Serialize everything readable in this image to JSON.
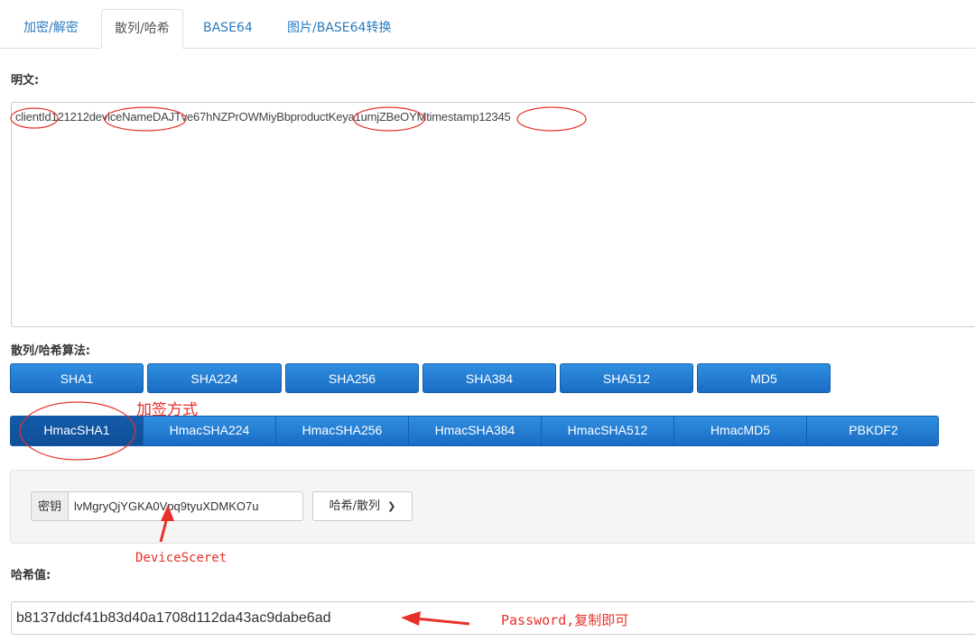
{
  "tabs": [
    "加密/解密",
    "散列/哈希",
    "BASE64",
    "图片/BASE64转换"
  ],
  "plaintext_label": "明文:",
  "plaintext": "clientId121212deviceNameDAJTve67hNZPrOWMiyBbproductKeya1umjZBeOYMtimestamp12345",
  "algo_label": "散列/哈希算法:",
  "hash_buttons": [
    "SHA1",
    "SHA224",
    "SHA256",
    "SHA384",
    "SHA512",
    "MD5"
  ],
  "hmac_buttons": [
    "HmacSHA1",
    "HmacSHA224",
    "HmacSHA256",
    "HmacSHA384",
    "HmacSHA512",
    "HmacMD5",
    "PBKDF2"
  ],
  "key_label": "密钥",
  "key_value": "lvMgryQjYGKA0Vpq9tyuXDMKO7u",
  "hash_dropdown": "哈希/散列",
  "result_label": "哈希值:",
  "result_value": "b8137ddcf41b83d40a1708d112da43ac9dabe6ad",
  "annotations": {
    "sign_method": "加签方式",
    "device_secret": "DeviceSceret",
    "password_note": "Password,复制即可"
  },
  "colors": {
    "button": "#1f75cc",
    "annotation": "#e8302a",
    "link": "#2a7bc0"
  }
}
